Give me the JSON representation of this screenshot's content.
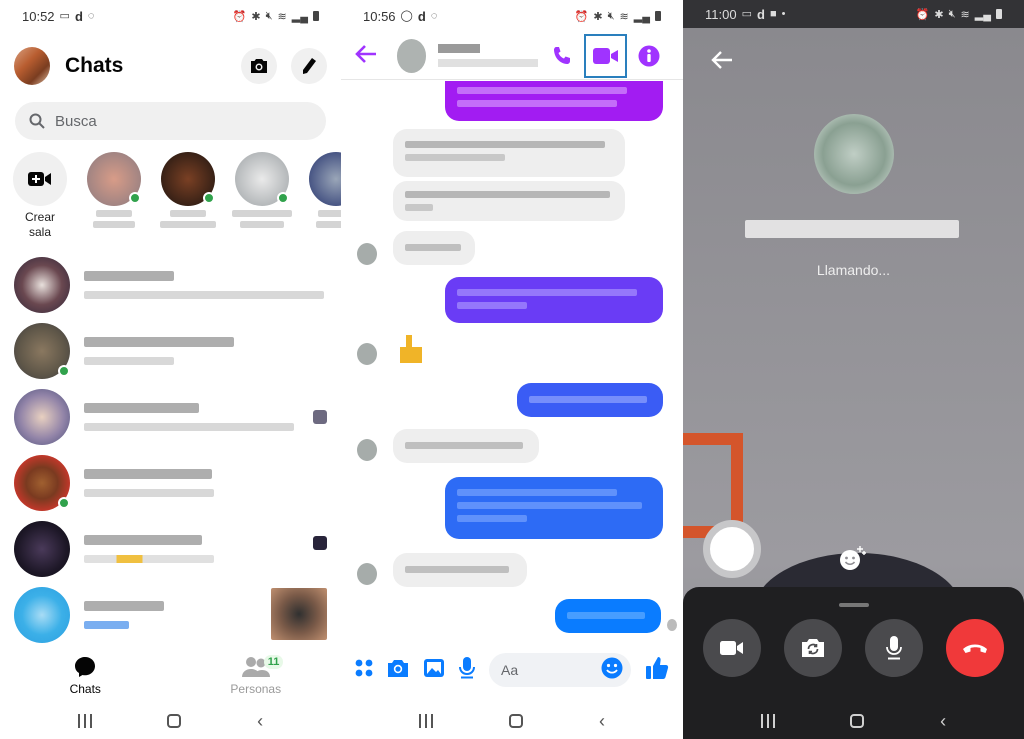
{
  "panel_chats": {
    "status_bar": {
      "time": "10:52"
    },
    "header": {
      "title": "Chats",
      "camera_icon": "camera-icon",
      "compose_icon": "pencil-icon"
    },
    "search": {
      "placeholder": "Busca"
    },
    "stories": [
      {
        "label": "Crear sala",
        "type": "create-room",
        "icon": "video-plus-icon"
      },
      {
        "label": "",
        "online": true,
        "color": "#c09080"
      },
      {
        "label": "",
        "online": true,
        "color": "#3a2418"
      },
      {
        "label": "",
        "online": true,
        "color": "#9ea3a6"
      },
      {
        "label": "",
        "online": false,
        "color": "#3c4c80"
      }
    ],
    "chats": [
      {
        "avatar_color": "#5a4048",
        "online": false,
        "thumb": false
      },
      {
        "avatar_color": "#5e5648",
        "online": true,
        "thumb": false
      },
      {
        "avatar_color": "#9284a8",
        "online": false,
        "thumb": true
      },
      {
        "avatar_color": "#7a3a20",
        "online": true,
        "thumb": false
      },
      {
        "avatar_color": "#1e1828",
        "online": false,
        "thumb": true
      },
      {
        "avatar_color": "#3cb0e8",
        "online": false,
        "thumb": true
      }
    ],
    "tabbar": {
      "tabs": [
        {
          "label": "Chats",
          "active": true,
          "icon": "chat-bubble-icon"
        },
        {
          "label": "Personas",
          "active": false,
          "icon": "people-icon",
          "badge": "11"
        }
      ]
    }
  },
  "panel_conversation": {
    "status_bar": {
      "time": "10:56"
    },
    "header": {
      "back_icon": "arrow-left-icon",
      "actions": [
        "phone-icon",
        "video-camera-icon",
        "info-icon"
      ],
      "highlighted_action": "video-camera-icon"
    },
    "colors": {
      "accent": "#a033ff",
      "purple_bubble": "#a21cf2",
      "violet_bubble": "#6a3cf5",
      "blue_bubble": "#3a5cf5",
      "messenger_blue": "#0a7cff"
    },
    "composer": {
      "placeholder": "Aa",
      "actions": [
        "apps-icon",
        "camera-icon",
        "gallery-icon",
        "microphone-icon"
      ],
      "emoji_icon": "emoji-icon",
      "like_icon": "thumbs-up-icon"
    }
  },
  "panel_call": {
    "status_bar": {
      "time": "11:00"
    },
    "call_status": "Llamando...",
    "controls": [
      {
        "name": "toggle-video",
        "icon": "video-camera-icon"
      },
      {
        "name": "flip-camera",
        "icon": "camera-flip-icon"
      },
      {
        "name": "mute",
        "icon": "microphone-icon"
      },
      {
        "name": "end-call",
        "icon": "hang-up-icon",
        "color": "#f0393a"
      }
    ],
    "effects_icon": "effects-smiley-icon"
  }
}
